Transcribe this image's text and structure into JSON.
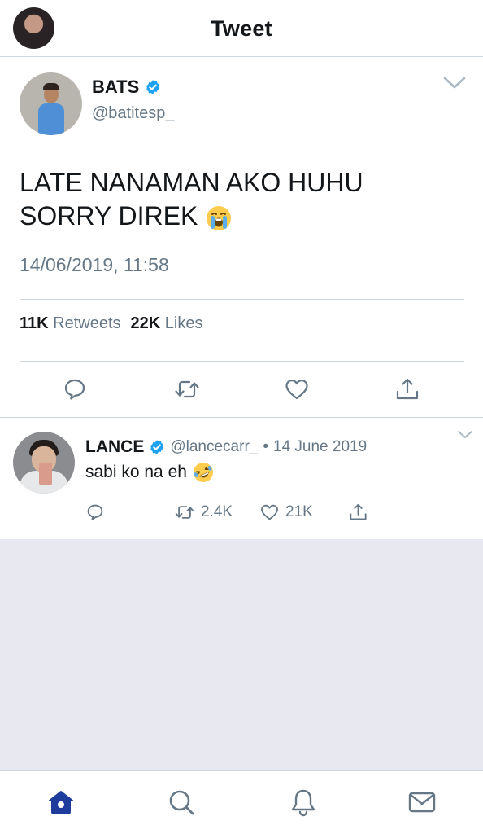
{
  "header": {
    "title": "Tweet"
  },
  "tweet": {
    "name": "BATS",
    "handle": "@batitesp_",
    "text_line1": "LATE NANAMAN AKO HUHU",
    "text_line2": "SORRY DIREK",
    "emoji": "loudly-crying-face-emoji",
    "timestamp": "14/06/2019, 11:58",
    "retweets_count": "11K",
    "retweets_label": "Retweets",
    "likes_count": "22K",
    "likes_label": "Likes"
  },
  "reply": {
    "name": "LANCE",
    "handle": "@lancecarr_",
    "separator": "•",
    "date": "14 June 2019",
    "text": "sabi ko na eh",
    "emoji": "rolling-on-the-floor-laughing-emoji",
    "retweets": "2.4K",
    "likes": "21K"
  },
  "tabbar": {
    "tabs": [
      "home-icon",
      "search-icon",
      "notifications-icon",
      "messages-icon"
    ]
  },
  "colors": {
    "brand_blue": "#1da1f2",
    "nav_active": "#1d3c9c",
    "muted_text": "#657786",
    "divider": "#cfd6dc",
    "empty_background": "#e8e8f1"
  }
}
